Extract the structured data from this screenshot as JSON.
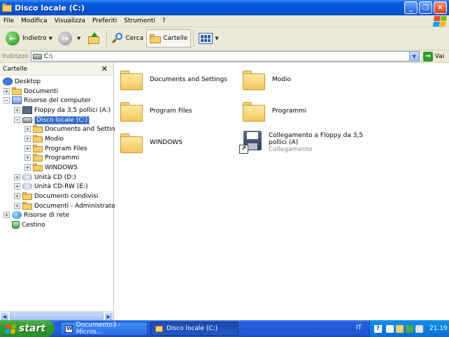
{
  "window": {
    "title": "Disco locale (C:)"
  },
  "menu": [
    "File",
    "Modifica",
    "Visualizza",
    "Preferiti",
    "Strumenti",
    "?"
  ],
  "toolbar": {
    "back_label": "Indietro",
    "search_label": "Cerca",
    "folders_label": "Cartelle"
  },
  "address": {
    "label": "Indirizzo",
    "value": "C:\\",
    "go_label": "Vai"
  },
  "folders_pane": {
    "title": "Cartelle",
    "tree": [
      {
        "label": "Desktop",
        "icon": "desktop-icon"
      },
      {
        "label": "Documenti",
        "icon": "folder-icon"
      },
      {
        "label": "Risorse del computer",
        "icon": "computer-icon"
      },
      {
        "label": "Floppy da 3,5 pollici (A:)",
        "icon": "floppy-icon"
      },
      {
        "label": "Disco locale (C:)",
        "icon": "drive-icon",
        "selected": true
      },
      {
        "label": "Documents and Settings",
        "icon": "folder-icon"
      },
      {
        "label": "Modio",
        "icon": "folder-icon"
      },
      {
        "label": "Program Files",
        "icon": "folder-icon"
      },
      {
        "label": "Programmi",
        "icon": "folder-icon"
      },
      {
        "label": "WINDOWS",
        "icon": "folder-icon"
      },
      {
        "label": "Unità CD (D:)",
        "icon": "cd-icon"
      },
      {
        "label": "Unità CD-RW (E:)",
        "icon": "cd-icon"
      },
      {
        "label": "Documenti condivisi",
        "icon": "folder-icon"
      },
      {
        "label": "Documenti - Administrator",
        "icon": "folder-icon"
      },
      {
        "label": "Risorse di rete",
        "icon": "network-icon"
      },
      {
        "label": "Cestino",
        "icon": "recycle-bin-icon"
      }
    ]
  },
  "content": {
    "items": [
      {
        "name": "Documents and Settings",
        "type": "folder"
      },
      {
        "name": "Modio",
        "type": "folder"
      },
      {
        "name": "Program Files",
        "type": "folder"
      },
      {
        "name": "Programmi",
        "type": "folder"
      },
      {
        "name": "WINDOWS",
        "type": "folder"
      },
      {
        "name": "Collegamento a Floppy da 3,5 pollici (A)",
        "subtitle": "Collegamento",
        "type": "shortcut"
      }
    ]
  },
  "taskbar": {
    "start_label": "start",
    "tasks": [
      "Documento3 - Micros...",
      "Disco locale (C:)"
    ],
    "language": "IT",
    "clock": "21.19"
  },
  "colors": {
    "titlebar": "#0553d6",
    "selection": "#316ac5",
    "taskbar": "#245edb",
    "start": "#2e9a2e"
  }
}
